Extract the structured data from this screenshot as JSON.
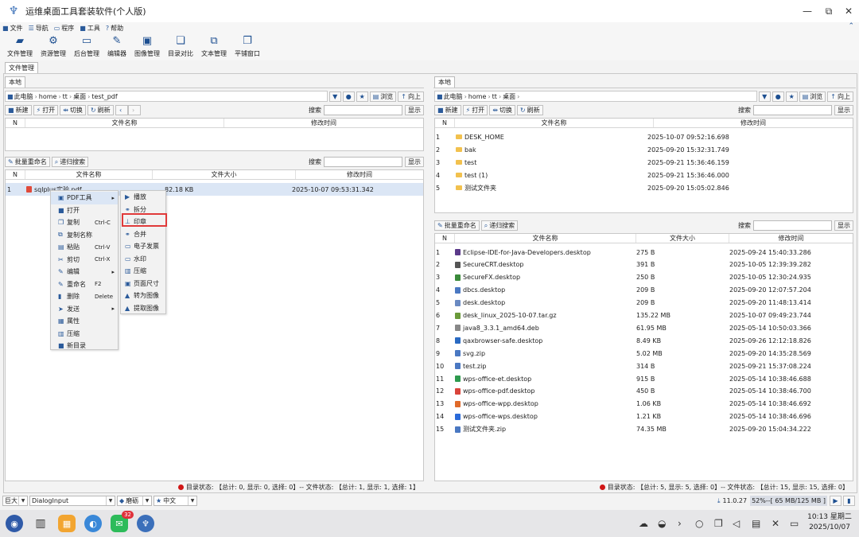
{
  "window": {
    "title": "运维桌面工具套装软件(个人版)",
    "controls": [
      "—",
      "⧉",
      "✕"
    ]
  },
  "menu": [
    {
      "icon": "file-icon",
      "label": "文件"
    },
    {
      "icon": "nav-icon",
      "label": "导航"
    },
    {
      "icon": "program-icon",
      "label": "程序"
    },
    {
      "icon": "tools-icon",
      "label": "工具"
    },
    {
      "icon": "help-icon",
      "label": "帮助"
    }
  ],
  "toolbar": [
    {
      "icon": "folder-open-icon",
      "label": "文件管理"
    },
    {
      "icon": "resource-icon",
      "label": "资源管理"
    },
    {
      "icon": "monitor-icon",
      "label": "后台管理"
    },
    {
      "icon": "edit-icon",
      "label": "编辑器"
    },
    {
      "icon": "image-icon",
      "label": "图像管理"
    },
    {
      "icon": "compare-icon",
      "label": "目录对比"
    },
    {
      "icon": "text-icon",
      "label": "文本管理"
    },
    {
      "icon": "window-icon",
      "label": "平铺窗口"
    }
  ],
  "main_tab": "文件管理",
  "left": {
    "tab": "本地",
    "path": [
      "此电脑",
      "home",
      "tt",
      "桌面",
      "test_pdf"
    ],
    "browse": "浏览",
    "up": "向上",
    "actions": {
      "new": "新建",
      "open": "打开",
      "switch": "切换",
      "refresh": "刷新"
    },
    "search_label": "搜索",
    "show": "显示",
    "upper_cols": [
      "N",
      "文件名称",
      "修改时间"
    ],
    "batch_rename": "批量重命名",
    "recursive_search": "递归搜索",
    "lower_cols": [
      "N",
      "文件名称",
      "文件大小",
      "修改时间"
    ],
    "files": [
      {
        "n": "1",
        "name": "sqlplus实验.pdf",
        "size": "82.18 KB",
        "time": "2025-10-07 09:53:31.342"
      }
    ],
    "status": "目录状态: 【总计: 0, 显示: 0, 选择: 0】-- 文件状态: 【总计: 1, 显示: 1, 选择: 1】"
  },
  "right": {
    "tab": "本地",
    "path": [
      "此电脑",
      "home",
      "tt",
      "桌面"
    ],
    "browse": "浏览",
    "up": "向上",
    "actions": {
      "new": "新建",
      "open": "打开",
      "switch": "切换",
      "refresh": "刷新"
    },
    "search_label": "搜索",
    "show": "显示",
    "upper_cols": [
      "N",
      "文件名称",
      "修改时间"
    ],
    "dirs": [
      {
        "n": "1",
        "name": "DESK_HOME",
        "time": "2025-10-07 09:52:16.698"
      },
      {
        "n": "2",
        "name": "bak",
        "time": "2025-09-20 15:32:31.749"
      },
      {
        "n": "3",
        "name": "test",
        "time": "2025-09-21 15:36:46.159"
      },
      {
        "n": "4",
        "name": "test (1)",
        "time": "2025-09-21 15:36:46.000"
      },
      {
        "n": "5",
        "name": "测试文件夹",
        "time": "2025-09-20 15:05:02.846"
      }
    ],
    "batch_rename": "批量重命名",
    "recursive_search": "递归搜索",
    "lower_cols": [
      "N",
      "文件名称",
      "文件大小",
      "修改时间"
    ],
    "files": [
      {
        "n": "1",
        "name": "Eclipse-IDE-for-Java-Developers.desktop",
        "size": "275 B",
        "time": "2025-09-24 15:40:33.286",
        "color": "#5b3a8a"
      },
      {
        "n": "2",
        "name": "SecureCRT.desktop",
        "size": "391 B",
        "time": "2025-10-05 12:39:39.282",
        "color": "#555555"
      },
      {
        "n": "3",
        "name": "SecureFX.desktop",
        "size": "250 B",
        "time": "2025-10-05 12:30:24.935",
        "color": "#3a8a3a"
      },
      {
        "n": "4",
        "name": "dbcs.desktop",
        "size": "209 B",
        "time": "2025-09-20 12:07:57.204",
        "color": "#4a78c2"
      },
      {
        "n": "5",
        "name": "desk.desktop",
        "size": "209 B",
        "time": "2025-09-20 11:48:13.414",
        "color": "#6a8ac2"
      },
      {
        "n": "6",
        "name": "desk_linux_2025-10-07.tar.gz",
        "size": "135.22 MB",
        "time": "2025-10-07 09:49:23.744",
        "color": "#6a9a3a"
      },
      {
        "n": "7",
        "name": "java8_3.3.1_amd64.deb",
        "size": "61.95 MB",
        "time": "2025-05-14 10:50:03.366",
        "color": "#888888"
      },
      {
        "n": "8",
        "name": "qaxbrowser-safe.desktop",
        "size": "8.49 KB",
        "time": "2025-09-26 12:12:18.826",
        "color": "#2a6ac2"
      },
      {
        "n": "9",
        "name": "svg.zip",
        "size": "5.02 MB",
        "time": "2025-09-20 14:35:28.569",
        "color": "#4a78c2"
      },
      {
        "n": "10",
        "name": "test.zip",
        "size": "314 B",
        "time": "2025-09-21 15:37:08.224",
        "color": "#4a78c2"
      },
      {
        "n": "11",
        "name": "wps-office-et.desktop",
        "size": "915 B",
        "time": "2025-05-14 10:38:46.688",
        "color": "#2e9a4e"
      },
      {
        "n": "12",
        "name": "wps-office-pdf.desktop",
        "size": "450 B",
        "time": "2025-05-14 10:38:46.700",
        "color": "#d9443a"
      },
      {
        "n": "13",
        "name": "wps-office-wpp.desktop",
        "size": "1.06 KB",
        "time": "2025-05-14 10:38:46.692",
        "color": "#e06a2a"
      },
      {
        "n": "14",
        "name": "wps-office-wps.desktop",
        "size": "1.21 KB",
        "time": "2025-05-14 10:38:46.696",
        "color": "#2a6ad9"
      },
      {
        "n": "15",
        "name": "测试文件夹.zip",
        "size": "74.35 MB",
        "time": "2025-09-20 15:04:34.222",
        "color": "#4a78c2"
      }
    ],
    "status": "目录状态: 【总计: 5, 显示: 5, 选择: 0】-- 文件状态: 【总计: 15, 显示: 15, 选择: 0】"
  },
  "context_menu": [
    {
      "label": "PDF工具",
      "icon": "pdf-icon",
      "submenu": true,
      "highlight": true
    },
    {
      "label": "打开",
      "icon": "open-icon"
    },
    {
      "label": "复制",
      "icon": "copy-icon",
      "shortcut": "Ctrl-C"
    },
    {
      "label": "复制名称",
      "icon": "copy-name-icon"
    },
    {
      "label": "粘贴",
      "icon": "paste-icon",
      "shortcut": "Ctrl-V"
    },
    {
      "label": "剪切",
      "icon": "cut-icon",
      "shortcut": "Ctrl-X"
    },
    {
      "label": "编辑",
      "icon": "edit-icon",
      "submenu": true
    },
    {
      "label": "重命名",
      "icon": "rename-icon",
      "shortcut": "F2"
    },
    {
      "label": "删除",
      "icon": "delete-icon",
      "shortcut": "Delete"
    },
    {
      "label": "发送",
      "icon": "send-icon",
      "submenu": true
    },
    {
      "label": "属性",
      "icon": "properties-icon"
    },
    {
      "label": "压缩",
      "icon": "compress-icon"
    },
    {
      "label": "新目录",
      "icon": "new-folder-icon"
    }
  ],
  "pdf_submenu": [
    {
      "label": "播放",
      "icon": "play-icon"
    },
    {
      "label": "拆分",
      "icon": "split-icon"
    },
    {
      "label": "印章",
      "icon": "stamp-icon",
      "boxed": true
    },
    {
      "label": "合并",
      "icon": "merge-icon"
    },
    {
      "label": "电子发票",
      "icon": "invoice-icon"
    },
    {
      "label": "水印",
      "icon": "watermark-icon"
    },
    {
      "label": "压缩",
      "icon": "compress-icon"
    },
    {
      "label": "页面尺寸",
      "icon": "page-size-icon"
    },
    {
      "label": "转为图像",
      "icon": "to-image-icon"
    },
    {
      "label": "提取图像",
      "icon": "extract-image-icon"
    }
  ],
  "bottom": {
    "size": "巨大",
    "input": "DialogInput",
    "theme": "磨砺",
    "lang": "中文",
    "version": "11.0.27",
    "memory": "52%--[ 65 MB/125 MB ]"
  },
  "taskbar": {
    "badge": "32",
    "time": "10:13 星期二",
    "date": "2025/10/07"
  },
  "colors": {
    "accent": "#1d4f91",
    "highlight_box": "#e03a3a",
    "selection": "#dbe6f5",
    "status_dot": "#d01616"
  }
}
